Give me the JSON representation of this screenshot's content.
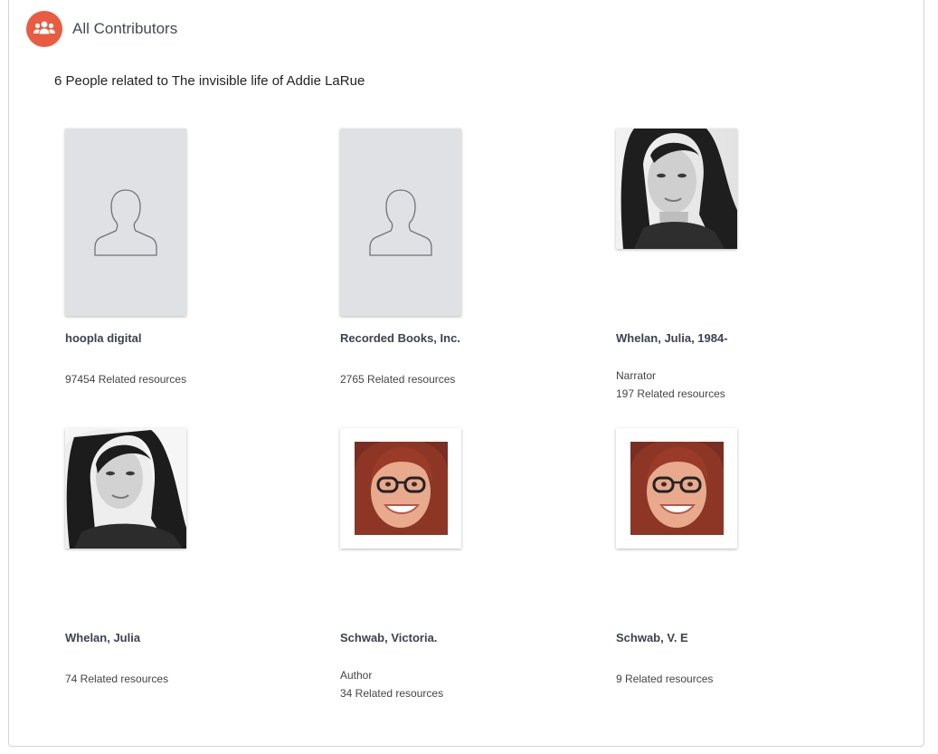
{
  "header": {
    "title": "All Contributors",
    "icon": "people-group-icon",
    "icon_color": "#e85c41"
  },
  "summary": "6 People related to The invisible life of Addie LaRue",
  "contributors": [
    {
      "name": "hoopla digital",
      "role": "",
      "related": "97454 Related resources",
      "image": "person-silhouette-icon"
    },
    {
      "name": "Recorded Books, Inc.",
      "role": "",
      "related": "2765 Related resources",
      "image": "person-silhouette-icon"
    },
    {
      "name": "Whelan, Julia, 1984-",
      "role": "Narrator",
      "related": "197 Related resources",
      "image": "portrait-photo"
    },
    {
      "name": "Whelan, Julia",
      "role": "",
      "related": "74 Related resources",
      "image": "portrait-photo"
    },
    {
      "name": "Schwab, Victoria.",
      "role": "Author",
      "related": "34 Related resources",
      "image": "portrait-photo"
    },
    {
      "name": "Schwab, V. E",
      "role": "",
      "related": "9 Related resources",
      "image": "portrait-photo"
    }
  ],
  "colors": {
    "placeholder_bg": "#dfe1e5",
    "name_text": "#3c4350",
    "accent": "#e85c41"
  }
}
